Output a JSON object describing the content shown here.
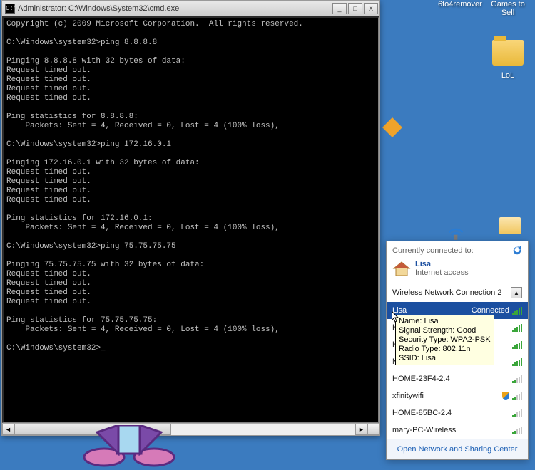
{
  "desktop": {
    "icons": [
      {
        "label": "6to4remover"
      },
      {
        "label": "Games to Sell"
      },
      {
        "label": "LoL"
      }
    ]
  },
  "cmd": {
    "title": "Administrator: C:\\Windows\\System32\\cmd.exe",
    "icon_text": "C:\\",
    "minimize": "_",
    "maximize": "□",
    "close": "X",
    "scroll_left": "◄",
    "scroll_right": "►",
    "output": "Copyright (c) 2009 Microsoft Corporation.  All rights reserved.\n\nC:\\Windows\\system32>ping 8.8.8.8\n\nPinging 8.8.8.8 with 32 bytes of data:\nRequest timed out.\nRequest timed out.\nRequest timed out.\nRequest timed out.\n\nPing statistics for 8.8.8.8:\n    Packets: Sent = 4, Received = 0, Lost = 4 (100% loss),\n\nC:\\Windows\\system32>ping 172.16.0.1\n\nPinging 172.16.0.1 with 32 bytes of data:\nRequest timed out.\nRequest timed out.\nRequest timed out.\nRequest timed out.\n\nPing statistics for 172.16.0.1:\n    Packets: Sent = 4, Received = 0, Lost = 4 (100% loss),\n\nC:\\Windows\\system32>ping 75.75.75.75\n\nPinging 75.75.75.75 with 32 bytes of data:\nRequest timed out.\nRequest timed out.\nRequest timed out.\nRequest timed out.\n\nPing statistics for 75.75.75.75:\n    Packets: Sent = 4, Received = 0, Lost = 4 (100% loss),\n\nC:\\Windows\\system32>_"
  },
  "network": {
    "header": "Currently connected to:",
    "current": {
      "name": "Lisa",
      "status": "Internet access"
    },
    "section": "Wireless Network Connection 2",
    "collapse": "▲",
    "selected": {
      "name": "Lisa",
      "state": "Connected"
    },
    "tooltip": {
      "l1": "Name: Lisa",
      "l2": "Signal Strength: Good",
      "l3": "Security Type: WPA2-PSK",
      "l4": "Radio Type: 802.11n",
      "l5": "SSID: Lisa"
    },
    "items": [
      {
        "name": "H"
      },
      {
        "name": "H"
      },
      {
        "name": "NETGEAR70"
      },
      {
        "name": "HOME-23F4-2.4"
      },
      {
        "name": "xfinitywifi"
      },
      {
        "name": "HOME-85BC-2.4"
      },
      {
        "name": "mary-PC-Wireless"
      }
    ],
    "footer": "Open Network and Sharing Center"
  }
}
